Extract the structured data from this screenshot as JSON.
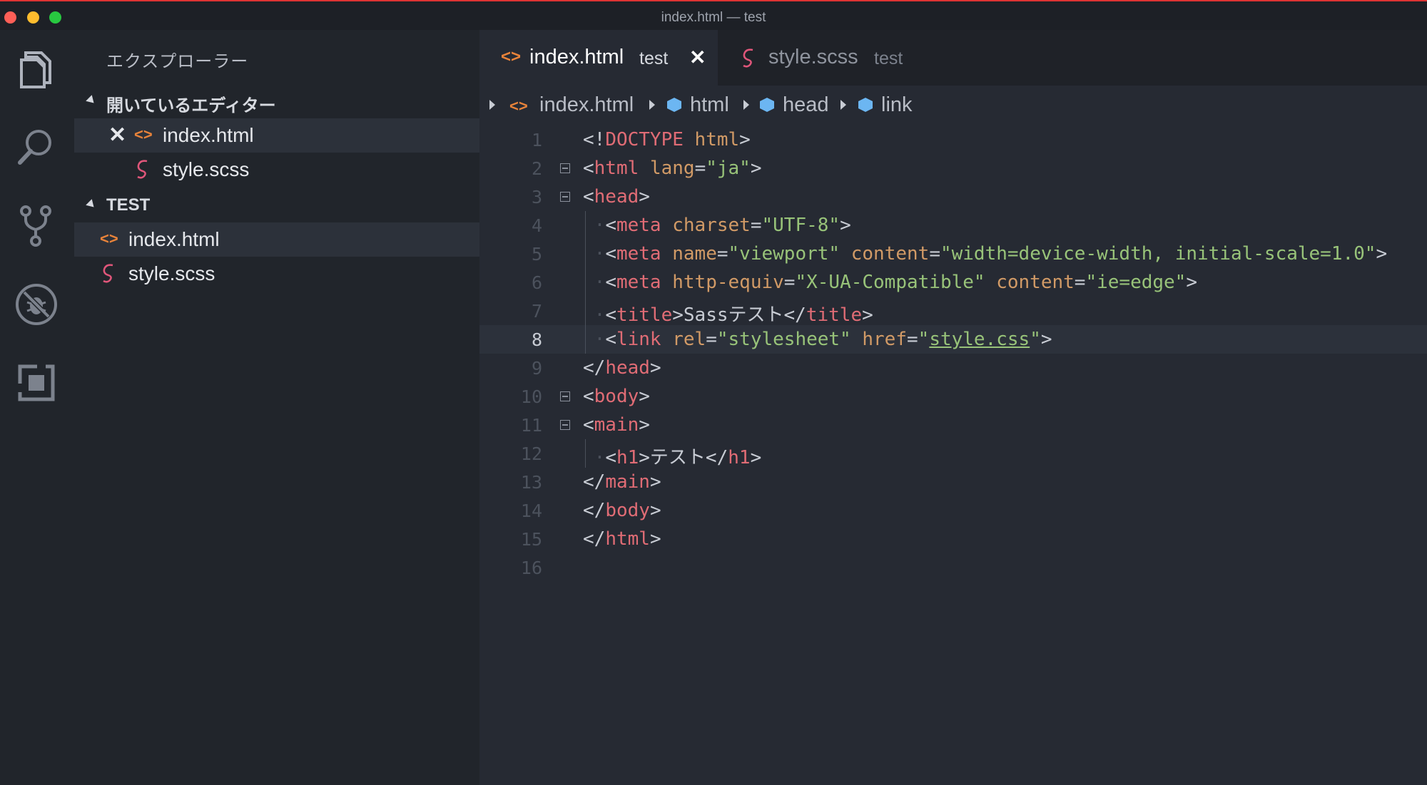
{
  "window": {
    "title": "index.html — test"
  },
  "activity_bar": {
    "icons": [
      "files-icon",
      "search-icon",
      "source-control-icon",
      "debug-icon",
      "extensions-icon"
    ]
  },
  "sidebar": {
    "title": "エクスプローラー",
    "open_editors": {
      "label": "開いているエディター",
      "items": [
        {
          "name": "index.html",
          "type": "html",
          "active": true
        },
        {
          "name": "style.scss",
          "type": "scss",
          "active": false
        }
      ]
    },
    "folder": {
      "label": "TEST",
      "items": [
        {
          "name": "index.html",
          "type": "html",
          "selected": true
        },
        {
          "name": "style.scss",
          "type": "scss",
          "selected": false
        }
      ]
    }
  },
  "tabs": [
    {
      "name": "index.html",
      "dir": "test",
      "active": true
    },
    {
      "name": "style.scss",
      "dir": "test",
      "active": false
    }
  ],
  "breadcrumb": [
    "index.html",
    "html",
    "head",
    "link"
  ],
  "editor": {
    "current_line": 8,
    "line_numbers": [
      "1",
      "2",
      "3",
      "4",
      "5",
      "6",
      "7",
      "8",
      "9",
      "10",
      "11",
      "12",
      "13",
      "14",
      "15",
      "16"
    ],
    "lines": [
      "<!DOCTYPE html>",
      "<html lang=\"ja\">",
      "<head>",
      "  <meta charset=\"UTF-8\">",
      "  <meta name=\"viewport\" content=\"width=device-width, initial-scale=1.0\">",
      "  <meta http-equiv=\"X-UA-Compatible\" content=\"ie=edge\">",
      "  <title>Sassテスト</title>",
      "  <link rel=\"stylesheet\" href=\"style.css\">",
      "</head>",
      "<body>",
      "<main>",
      "  <h1>テスト</h1>",
      "</main>",
      "</body>",
      "</html>",
      ""
    ]
  },
  "colors": {
    "tag": "#e06c75",
    "attribute": "#d19a66",
    "string": "#98c379",
    "html_icon": "#e8833a",
    "scss_icon": "#e0567a",
    "cube": "#6cb6f2"
  }
}
